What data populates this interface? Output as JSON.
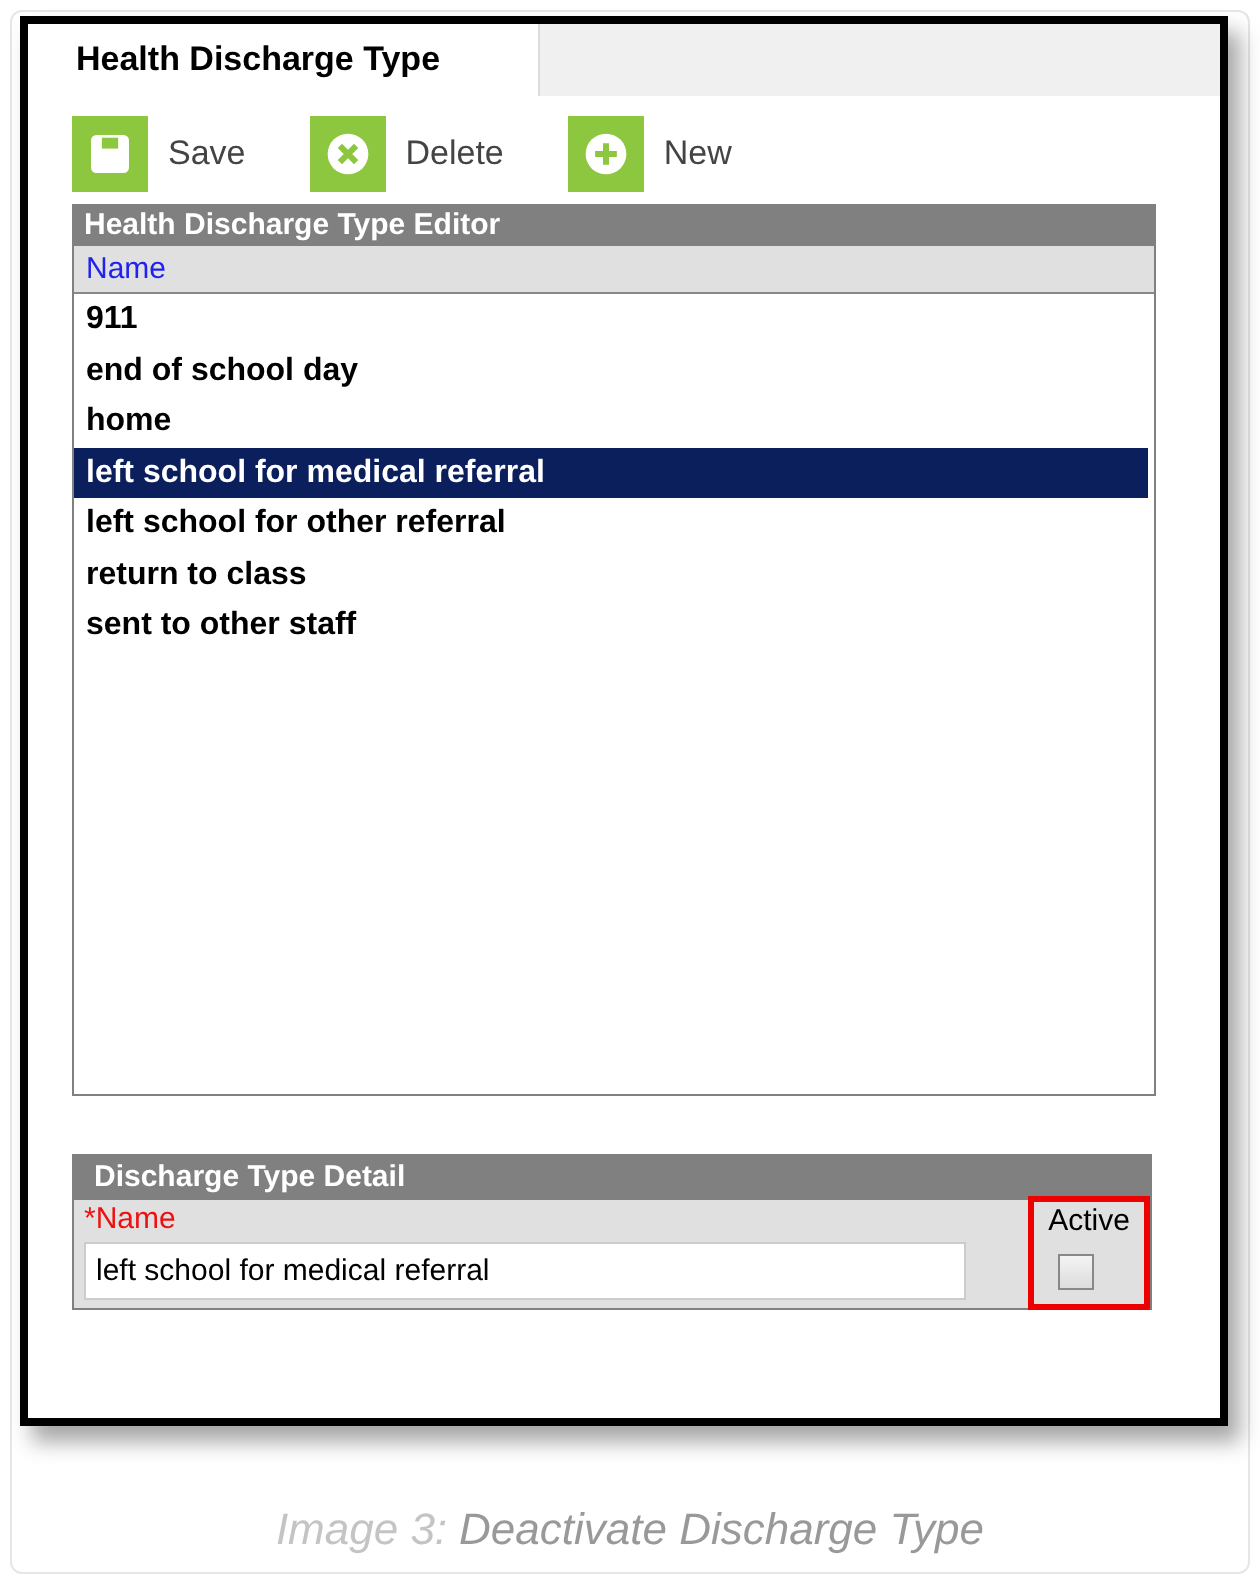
{
  "tab": {
    "label": "Health Discharge Type",
    "selected": true
  },
  "toolbar": [
    {
      "label": "Save",
      "kind": "save"
    },
    {
      "label": "Delete",
      "kind": "delete"
    },
    {
      "label": "New",
      "kind": "new"
    }
  ],
  "editor": {
    "title": "Health Discharge Type Editor",
    "column": "Name",
    "rows": [
      {
        "label": "911",
        "selected": false
      },
      {
        "label": "end of school day",
        "selected": false
      },
      {
        "label": "home",
        "selected": false
      },
      {
        "label": "left school for medical referral",
        "selected": true
      },
      {
        "label": "left school for other referral",
        "selected": false
      },
      {
        "label": "return to class",
        "selected": false
      },
      {
        "label": "sent to other staff",
        "selected": false
      }
    ]
  },
  "detail": {
    "title": "Discharge Type Detail",
    "name_label": "*Name",
    "name_value": "left school for medical referral",
    "active_label": "Active",
    "active_checked": false,
    "active_highlighted": true
  },
  "caption": {
    "label": "Image 3:",
    "text": "Deactivate Discharge Type"
  }
}
